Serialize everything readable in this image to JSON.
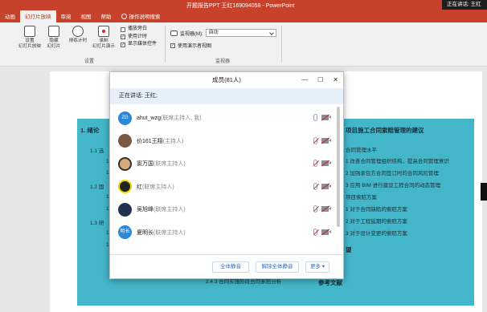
{
  "window": {
    "title": "开题报告PPT 王红169094058 - PowerPoint",
    "notification": "正在讲话: 王红"
  },
  "tabs": [
    {
      "label": "动画",
      "active": false
    },
    {
      "label": "幻灯片放映",
      "active": true
    },
    {
      "label": "审阅",
      "active": false
    },
    {
      "label": "视图",
      "active": false
    },
    {
      "label": "帮助",
      "active": false
    },
    {
      "label": "操作说明搜索",
      "active": false,
      "icon": "lightbulb-icon"
    }
  ],
  "ribbon": {
    "setup_slideshow": "设置\n幻灯片放映",
    "hide_slide": "隐藏\n幻灯片",
    "rehearse_timings": "排练计时",
    "record_slideshow": "录制\n幻灯片演示",
    "checks": [
      {
        "label": "播放旁白",
        "checked": false
      },
      {
        "label": "使用计时",
        "checked": true
      },
      {
        "label": "显示媒体控件",
        "checked": true
      }
    ],
    "group_setup": "设置",
    "monitor_label": "监视器(M):",
    "monitor_value": "自动",
    "presenter_view": "使用演示者视图",
    "presenter_checked": true,
    "group_monitor": "监视器"
  },
  "slide": {
    "left_heading": "1. 绪论",
    "left_items": [
      "1.1 选",
      "1.1",
      "1.1",
      "1.2 国",
      "1.2",
      "1.2",
      "1.3 研",
      "1.3",
      "1.3"
    ],
    "right_heading": "项目施工合同索赔管理的建议",
    "right_items": [
      "合同管理水平",
      "1 改善合同管理组织结构，提高合同管理意识",
      "2 加强承包方合同签订时的合同风险管理",
      "3 应用 BIM 进行建设工程合同的动态管理",
      "项目索赔方案",
      "1 对于合同缺陷的索赔方案",
      "2 对于工程延期的索赔方案",
      "3 对于设计变更的索赔方案"
    ],
    "right_tail_1": "望",
    "bottom_left": "2.4.3 合同实施阶段合同索赔分析",
    "bottom_right": "参考文献"
  },
  "dialog": {
    "title": "成员(81人)",
    "speaking": "正在讲话: 王红;",
    "members": [
      {
        "name": "ahut_wzg",
        "role": "(联席主持人, 我)",
        "avatar": "ZG",
        "avatar_style": "av-blue"
      },
      {
        "name": "价161王翔",
        "role": "(主持人)",
        "avatar": "",
        "avatar_style": "av-brown"
      },
      {
        "name": "窦万国",
        "role": "(联席主持人)",
        "avatar": "",
        "avatar_style": "av-face"
      },
      {
        "name": "红",
        "role": "(联席主持人)",
        "avatar": "",
        "avatar_style": "av-mask"
      },
      {
        "name": "吴旭峰",
        "role": "(联席主持人)",
        "avatar": "",
        "avatar_style": "av-dark"
      },
      {
        "name": "夏明长",
        "role": "(联席主持人)",
        "avatar": "明长",
        "avatar_style": "av-blue"
      }
    ],
    "mute_all": "全体静音",
    "unmute_all": "解除全体静音",
    "more": "更多 ▾"
  }
}
